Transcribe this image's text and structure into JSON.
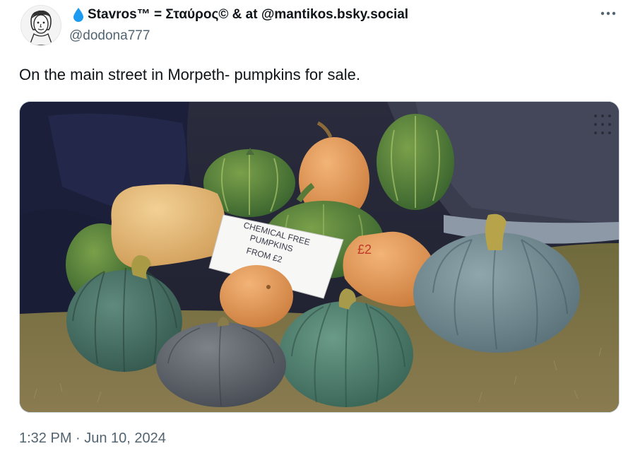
{
  "tweet": {
    "display_name": "Stavros™ = Σταύρος© & at @mantikos.bsky.social",
    "handle": "@dodona777",
    "text": "On the main street in Morpeth- pumpkins for sale.",
    "timestamp": "1:32 PM · Jun 10, 2024",
    "name_icon": "water-drop-icon",
    "more_icon": "more-options-icon"
  },
  "photo": {
    "sign_lines": [
      "CHEMICAL FREE",
      "PUMPKINS",
      "FROM £2"
    ],
    "price_tag": "£2"
  },
  "colors": {
    "text": "#0f1419",
    "secondary": "#536471",
    "drop": "#1d9bf0"
  }
}
